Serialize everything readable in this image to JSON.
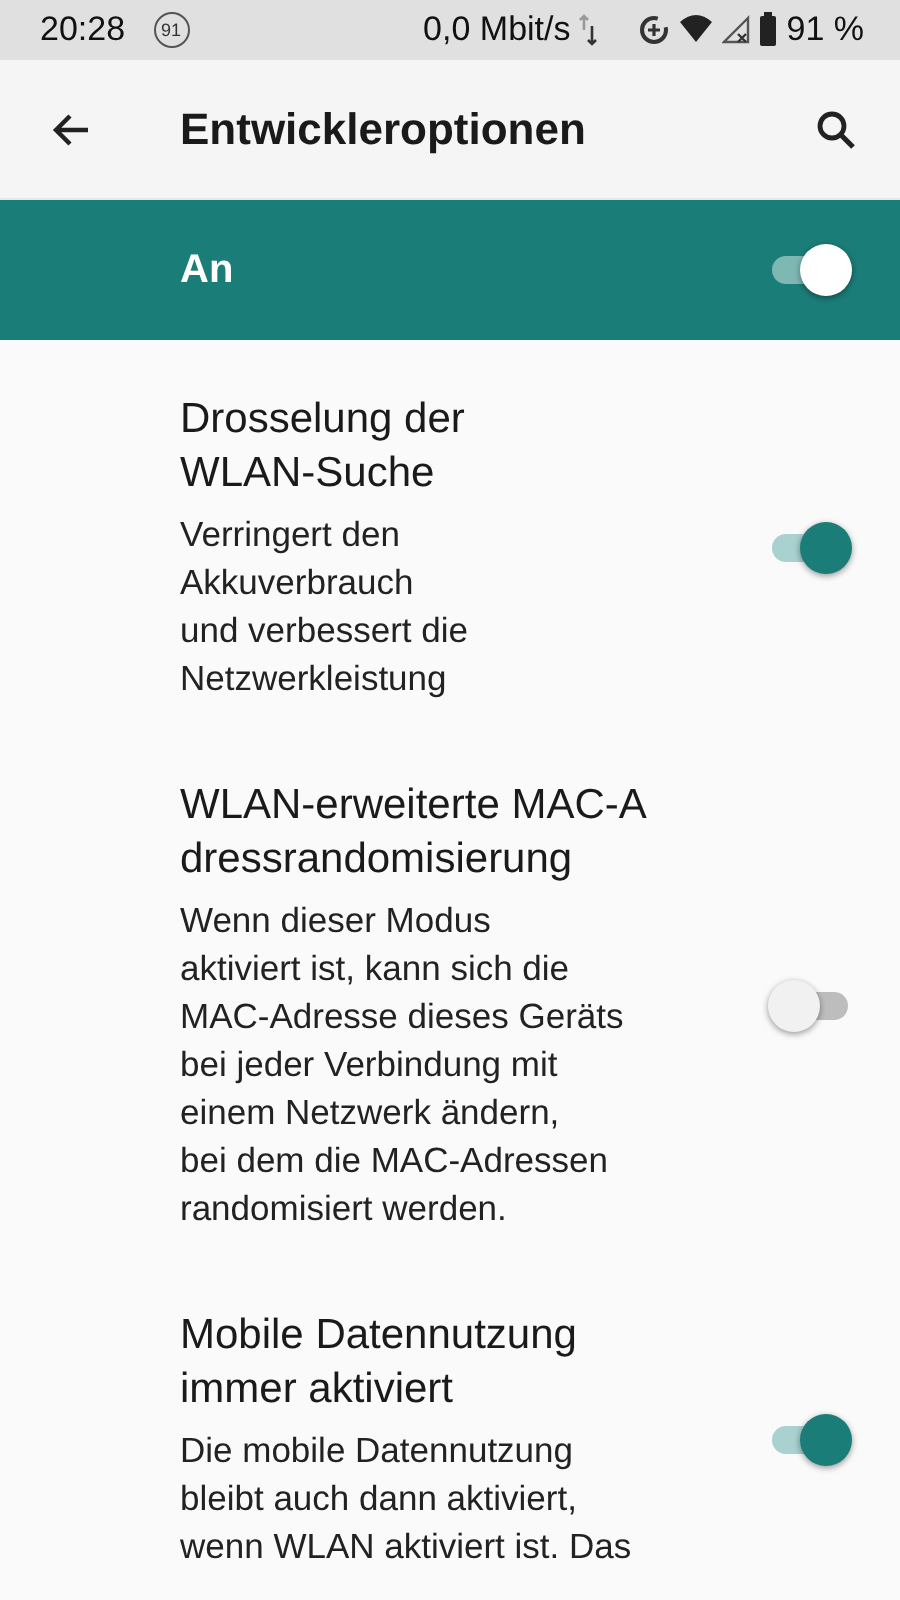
{
  "status_bar": {
    "time": "20:28",
    "notification_badge": "91",
    "network_speed": "0,0 Mbit/s",
    "battery": "91 %"
  },
  "app_bar": {
    "title": "Entwickleroptionen"
  },
  "master_switch": {
    "label": "An",
    "on": true
  },
  "settings": [
    {
      "title": "Drosselung der\nWLAN-Suche",
      "summary": "Verringert den\nAkkuverbrauch\nund verbessert die\nNetzwerkleistung",
      "on": true
    },
    {
      "title": "WLAN-erweiterte MAC-A\ndressrandomisierung",
      "summary": "Wenn dieser Modus\naktiviert ist, kann sich die\nMAC-Adresse dieses Geräts\nbei jeder Verbindung mit\neinem Netzwerk ändern,\nbei dem die MAC-Adressen\nrandomisiert werden.",
      "on": false
    },
    {
      "title": "Mobile Datennutzung\nimmer aktiviert",
      "summary": "Die mobile Datennutzung\nbleibt auch dann aktiviert,\nwenn WLAN aktiviert ist. Das",
      "on": true
    }
  ]
}
